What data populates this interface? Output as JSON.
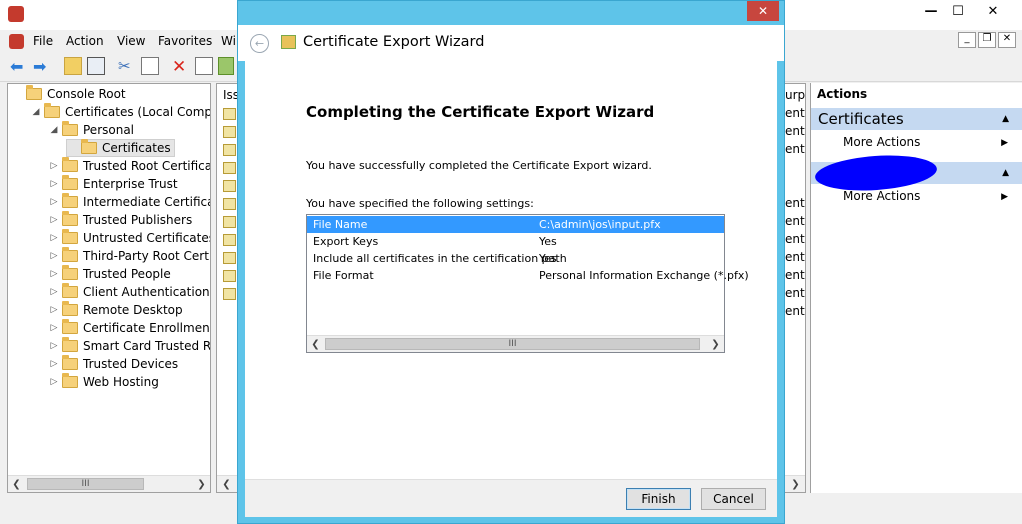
{
  "mmc": {
    "menu": [
      "File",
      "Action",
      "View",
      "Favorites",
      "Wi"
    ],
    "tree": [
      {
        "label": "Console Root",
        "level": 0,
        "expander": ""
      },
      {
        "label": "Certificates (Local Computer)",
        "level": 1,
        "expander": "◢"
      },
      {
        "label": "Personal",
        "level": 2,
        "expander": "◢"
      },
      {
        "label": "Certificates",
        "level": 3,
        "expander": ""
      },
      {
        "label": "Trusted Root Certification A",
        "level": 2,
        "expander": "▷"
      },
      {
        "label": "Enterprise Trust",
        "level": 2,
        "expander": "▷"
      },
      {
        "label": "Intermediate Certification A",
        "level": 2,
        "expander": "▷"
      },
      {
        "label": "Trusted Publishers",
        "level": 2,
        "expander": "▷"
      },
      {
        "label": "Untrusted Certificates",
        "level": 2,
        "expander": "▷"
      },
      {
        "label": "Third-Party Root Certificati",
        "level": 2,
        "expander": "▷"
      },
      {
        "label": "Trusted People",
        "level": 2,
        "expander": "▷"
      },
      {
        "label": "Client Authentication Issue",
        "level": 2,
        "expander": "▷"
      },
      {
        "label": "Remote Desktop",
        "level": 2,
        "expander": "▷"
      },
      {
        "label": "Certificate Enrollment Requ",
        "level": 2,
        "expander": "▷"
      },
      {
        "label": "Smart Card Trusted Roots",
        "level": 2,
        "expander": "▷"
      },
      {
        "label": "Trusted Devices",
        "level": 2,
        "expander": "▷"
      },
      {
        "label": "Web Hosting",
        "level": 2,
        "expander": "▷"
      }
    ],
    "mid_header": "Iss",
    "right_col_header": "urpo",
    "right_col_cells": [
      "enti",
      "enti",
      "enti",
      "enti",
      "enti",
      "enti",
      "enti",
      "enti",
      "enti",
      "enti"
    ],
    "scroll_grip": "III",
    "actions": {
      "title": "Actions",
      "section1": "Certificates",
      "section1_link": "More Actions",
      "section2_link": "More Actions"
    }
  },
  "wizard": {
    "title": "Certificate Export Wizard",
    "close": "✕",
    "heading": "Completing the Certificate Export Wizard",
    "success_text": "You have successfully completed the Certificate Export wizard.",
    "settings_label": "You have specified the following settings:",
    "settings": [
      {
        "key": "File Name",
        "value": "C:\\admin\\jos\\input.pfx"
      },
      {
        "key": "Export Keys",
        "value": "Yes"
      },
      {
        "key": "Include all certificates in the certification path",
        "value": "Yes"
      },
      {
        "key": "File Format",
        "value": "Personal Information Exchange (*.pfx)"
      }
    ],
    "finish_label": "Finish",
    "cancel_label": "Cancel"
  },
  "colors": {
    "wizard_frame": "#5ec4e9",
    "selection": "#3399ff",
    "actions_header": "#c5d9f1",
    "close_button": "#c7463e",
    "redaction": "#0000ff"
  }
}
